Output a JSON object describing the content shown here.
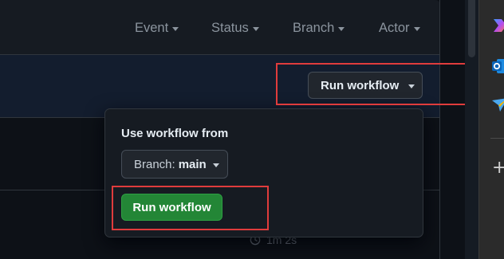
{
  "filters": {
    "event": "Event",
    "status": "Status",
    "branch": "Branch",
    "actor": "Actor"
  },
  "run_workflow_button": {
    "label": "Run workflow"
  },
  "popover": {
    "title": "Use workflow from",
    "branch_prefix": "Branch:",
    "branch_name": "main",
    "submit_label": "Run workflow"
  },
  "run_item": {
    "duration": "1m 2s"
  },
  "icons": {
    "filter_caret": "chevron-down-icon",
    "duration": "clock-icon",
    "sidebar": [
      "copilot-icon",
      "outlook-icon",
      "send-icon",
      "plus-icon"
    ]
  },
  "colors": {
    "page_bg": "#0d1117",
    "green_button": "#238636",
    "annotation_red": "#e03c3c",
    "highlight_row": "#131d2e"
  }
}
